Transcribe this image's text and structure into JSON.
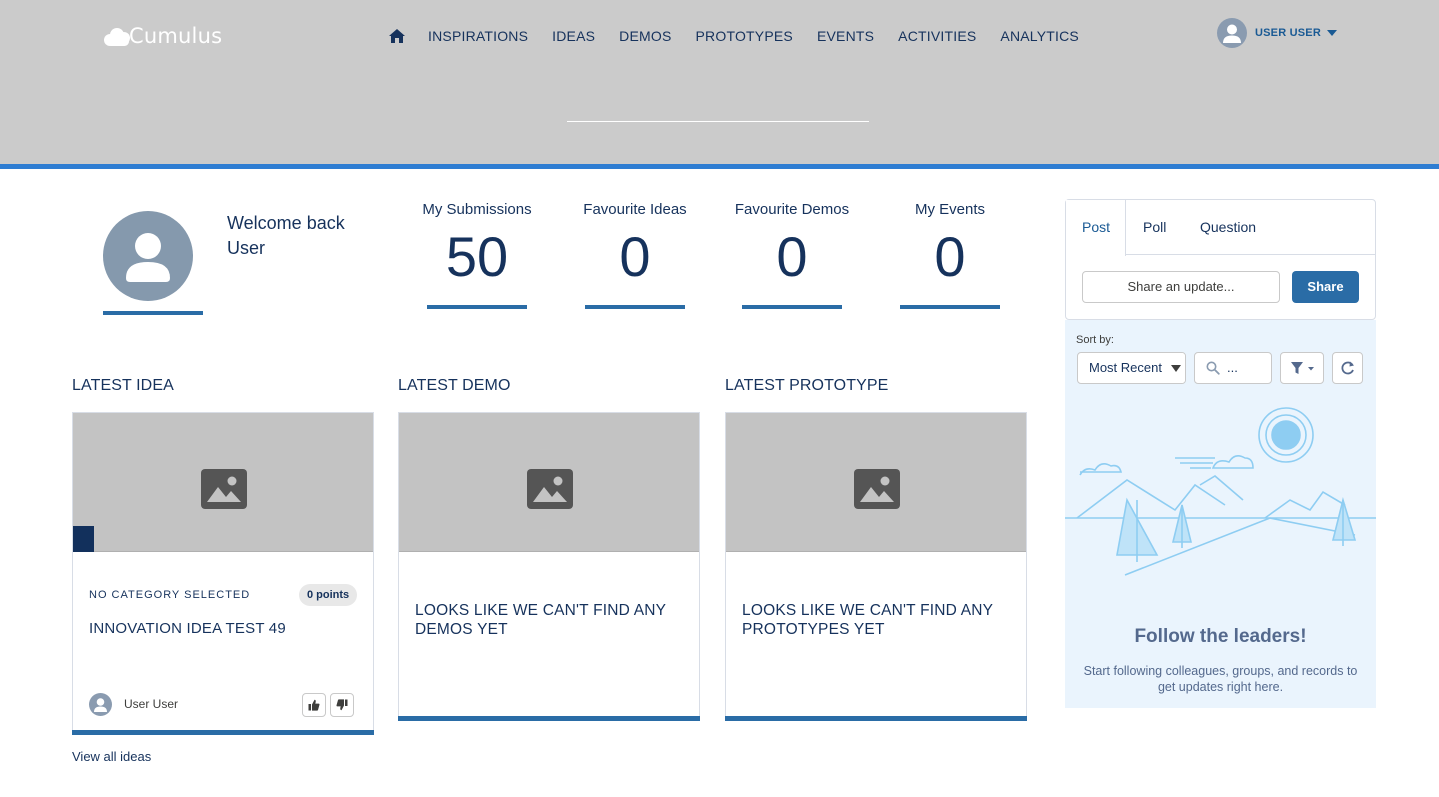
{
  "brand": {
    "name": "Cumulus"
  },
  "nav": {
    "home_icon": "home-icon",
    "items": [
      "INSPIRATIONS",
      "IDEAS",
      "DEMOS",
      "PROTOTYPES",
      "EVENTS",
      "ACTIVITIES",
      "ANALYTICS"
    ]
  },
  "user_menu": {
    "name": "USER USER",
    "avatar_icon": "user-avatar-icon"
  },
  "profile": {
    "welcome_line1": "Welcome back",
    "welcome_line2": "User"
  },
  "stats": [
    {
      "label": "My Submissions",
      "value": "50"
    },
    {
      "label": "Favourite Ideas",
      "value": "0"
    },
    {
      "label": "Favourite Demos",
      "value": "0"
    },
    {
      "label": "My Events",
      "value": "0"
    }
  ],
  "sections": {
    "idea": {
      "title": "LATEST IDEA",
      "category": "NO CATEGORY SELECTED",
      "points": "0 points",
      "card_title": "INNOVATION IDEA TEST 49",
      "author": "User User",
      "view_all": "View all ideas"
    },
    "demo": {
      "title": "LATEST DEMO",
      "empty": "LOOKS LIKE WE CAN'T FIND ANY DEMOS YET"
    },
    "prototype": {
      "title": "LATEST PROTOTYPE",
      "empty": "LOOKS LIKE WE CAN'T FIND ANY PROTOTYPES YET"
    }
  },
  "publisher": {
    "tabs": [
      "Post",
      "Poll",
      "Question"
    ],
    "active_tab": "Post",
    "input_placeholder": "Share an update...",
    "share_label": "Share"
  },
  "feed": {
    "sort_label": "Sort by:",
    "sort_value": "Most Recent Activity",
    "search_placeholder": "...",
    "empty_title": "Follow the leaders!",
    "empty_text": "Start following colleagues, groups, and records to get updates right here."
  },
  "colors": {
    "header_bg": "#cbcbcb",
    "accent_bar": "#2e7dd2",
    "brand_blue": "#2a6ca6",
    "text_navy": "#16325c",
    "feed_bg": "#eaf4fd"
  }
}
